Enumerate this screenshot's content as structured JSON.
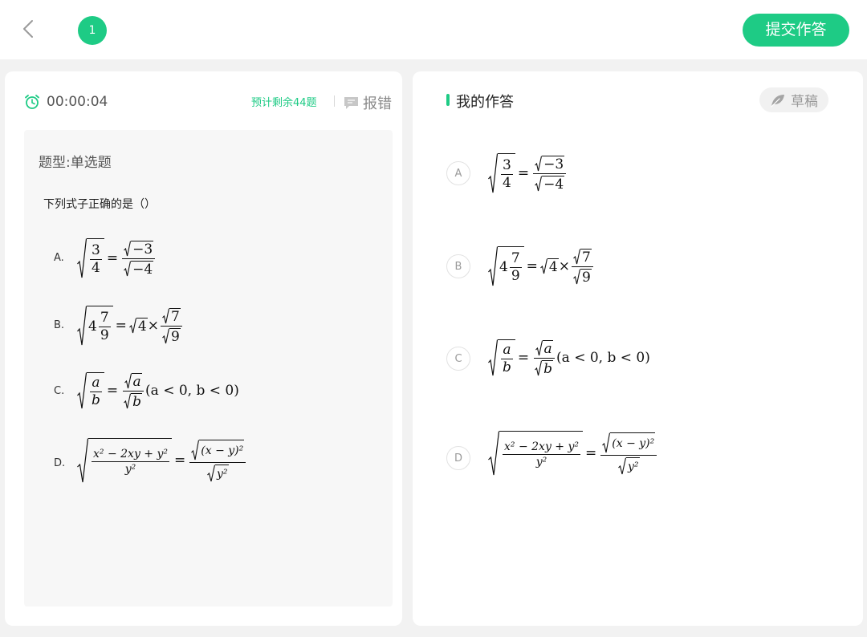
{
  "header": {
    "back_icon": "chevron-left-icon",
    "question_number": "1",
    "submit_label": "提交作答",
    "accent_color": "#1ecb85"
  },
  "left_panel": {
    "timer_icon": "alarm-clock-icon",
    "timer": "00:00:04",
    "remaining_text": "预计剩余44题",
    "report_icon": "comment-icon",
    "report_label": "报错",
    "question_type": "题型:单选题",
    "question_stem": "下列式子正确的是（）",
    "options": [
      {
        "letter": "A."
      },
      {
        "letter": "B."
      },
      {
        "letter": "C."
      },
      {
        "letter": "D."
      }
    ]
  },
  "right_panel": {
    "title": "我的作答",
    "draft_icon": "leaf-icon",
    "draft_label": "草稿",
    "choices": [
      {
        "letter": "A"
      },
      {
        "letter": "B"
      },
      {
        "letter": "C"
      },
      {
        "letter": "D"
      }
    ]
  },
  "math": {
    "n3": "3",
    "n4": "4",
    "neg3": "−3",
    "neg4": "−4",
    "n7": "7",
    "n9": "9",
    "eq": "=",
    "times": "×",
    "a": "a",
    "b": "b",
    "cond": "(a < 0, b < 0)",
    "d_num": "x² − 2xy + y²",
    "d_den": "y²",
    "xy_sq": "(x − y)²",
    "y_sq": "y²"
  }
}
